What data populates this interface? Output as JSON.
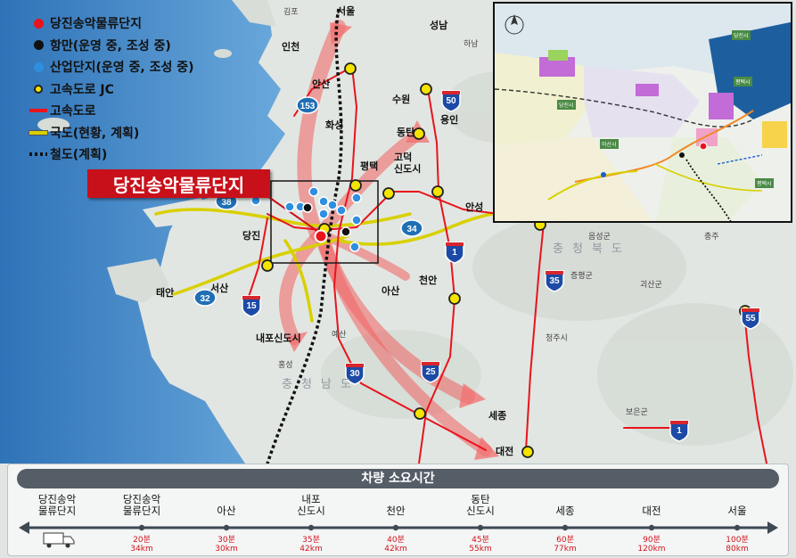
{
  "legend": [
    {
      "label": "당진송악물류단지",
      "symbol": "red-dot-icon",
      "color": "#e8141c"
    },
    {
      "label": "항만(운영 중, 조성 중)",
      "symbol": "black-dot-icon",
      "color": "#111111"
    },
    {
      "label": "산업단지(운영 중, 조성 중)",
      "symbol": "blue-dot-icon",
      "color": "#2e8fe0"
    },
    {
      "label": "고속도로 JC",
      "symbol": "yellow-ring-icon",
      "color": "#f4e400"
    },
    {
      "label": "고속도로",
      "symbol": "red-line-icon",
      "color": "#e8141c"
    },
    {
      "label": "국도(현황, 계획)",
      "symbol": "yellow-line-icon",
      "color": "#d8d000"
    },
    {
      "label": "철도(계획)",
      "symbol": "dotted-line-icon",
      "color": "#111111"
    }
  ],
  "callout": "당진송악물류단지",
  "map_labels": {
    "seoul": "서울",
    "seongnam": "성남",
    "incheon": "인천",
    "ansan": "안산",
    "suwon": "수원",
    "yongin": "용인",
    "hwaseong": "화성",
    "dongtan": "동탄",
    "godeok": "고덕\n신도시",
    "pyeongtaek": "평택",
    "anseong": "안성",
    "dangjin": "당진",
    "asan": "아산",
    "cheonan": "천안",
    "seosan": "서산",
    "taean": "태안",
    "naepo": "내포신도시",
    "sejong": "세종",
    "daejeon": "대전",
    "hongseong": "홍성",
    "yesan": "예산",
    "cheongju": "청주시",
    "jeungpyeong": "증평군",
    "goesan": "괴산군",
    "boeun": "보은군",
    "chungju": "충주",
    "eumseong": "음성군",
    "gimpo": "김포",
    "hanam": "하남",
    "chungnam": "충청남도",
    "chungbuk": "충청북도"
  },
  "road_shields": [
    {
      "number": "50",
      "type": "expressway"
    },
    {
      "number": "153",
      "type": "national"
    },
    {
      "number": "38",
      "type": "national"
    },
    {
      "number": "34",
      "type": "national"
    },
    {
      "number": "32",
      "type": "national"
    },
    {
      "number": "1",
      "type": "expressway"
    },
    {
      "number": "15",
      "type": "expressway"
    },
    {
      "number": "35",
      "type": "expressway"
    },
    {
      "number": "30",
      "type": "expressway"
    },
    {
      "number": "25",
      "type": "expressway"
    },
    {
      "number": "55",
      "type": "expressway"
    },
    {
      "number": "1",
      "type": "expressway"
    }
  ],
  "inset": {
    "labels": [
      "당진시",
      "평택시",
      "아산시",
      "평택시",
      "당진시"
    ]
  },
  "timebar": {
    "title": "차량 소요시간",
    "stops": [
      {
        "name": "당진송악\n물류단지",
        "time": ""
      },
      {
        "name": "당진송악\n물류단지",
        "time": "20분\n34km"
      },
      {
        "name": "아산",
        "time": "30분\n30km"
      },
      {
        "name": "내포\n신도시",
        "time": "35분\n42km"
      },
      {
        "name": "천안",
        "time": "40분\n42km"
      },
      {
        "name": "동탄\n신도시",
        "time": "45분\n55km"
      },
      {
        "name": "세종",
        "time": "60분\n77km"
      },
      {
        "name": "대전",
        "time": "90분\n120km"
      },
      {
        "name": "서울",
        "time": "100분\n80km"
      }
    ]
  },
  "colors": {
    "sea": "#3f86c7",
    "land": "#e4e7e3",
    "highway": "#e8141c",
    "site": "#c8101a"
  }
}
